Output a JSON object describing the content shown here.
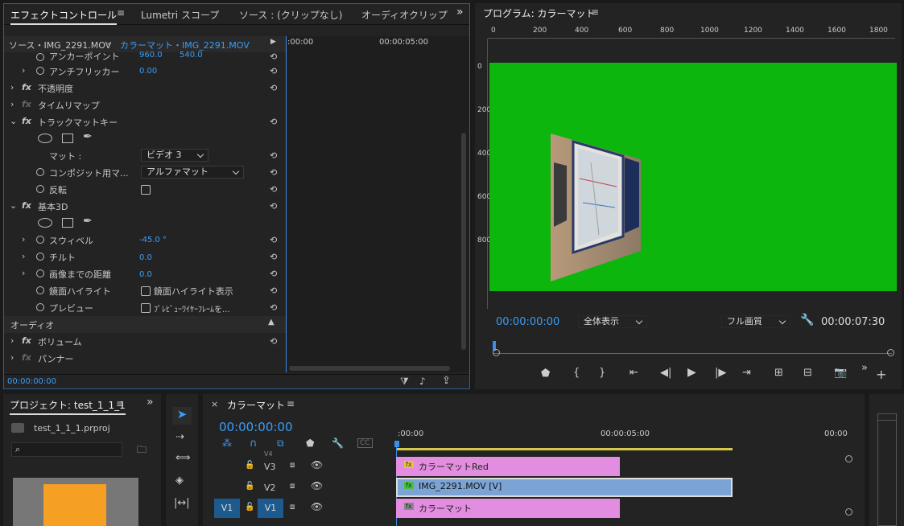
{
  "effect_panel": {
    "tabs": [
      "エフェクトコントロール",
      "Lumetri スコープ",
      "ソース : (クリップなし)",
      "オーディオクリップ"
    ],
    "menu_icon": "hamburger-icon",
    "source_label": "ソース・IMG_2291.MOV",
    "clip_label": "カラーマット・IMG_2291.MOV",
    "time_start": ":00:00",
    "time_mid": "00:00:05:00",
    "anchor": {
      "label": "アンカーポイント",
      "x": "960.0",
      "y": "540.0"
    },
    "antiflicker": {
      "label": "アンチフリッカー",
      "value": "0.00"
    },
    "opacity": "不透明度",
    "timeremap": "タイムリマップ",
    "trackmatte": "トラックマットキー",
    "matte": {
      "label": "マット :",
      "value": "ビデオ 3"
    },
    "composite": {
      "label": "コンポジット用マ...",
      "value": "アルファマット"
    },
    "invert": "反転",
    "basic3d": "基本3D",
    "swivel": {
      "label": "スウィベル",
      "value": "-45.0 °"
    },
    "tilt": {
      "label": "チルト",
      "value": "0.0"
    },
    "distance": {
      "label": "画像までの距離",
      "value": "0.0"
    },
    "specular": {
      "label": "鏡面ハイライト",
      "check_label": "鏡面ハイライト表示"
    },
    "preview": {
      "label": "プレビュー",
      "check_label": "ﾌﾟﾚﾋﾞｭｰﾜｲﾔｰﾌﾚｰﾑを..."
    },
    "audio_header": "オーディオ",
    "volume": "ボリューム",
    "panner": "パンナー",
    "footer_time": "00:00:00:00"
  },
  "program": {
    "title": "プログラム: カラーマット",
    "ruler": [
      "0",
      "200",
      "400",
      "600",
      "800",
      "1000",
      "1200",
      "1400",
      "1600",
      "1800"
    ],
    "vruler": [
      "0",
      "200",
      "400",
      "600",
      "800"
    ],
    "timecode": "00:00:00:00",
    "zoom": "全体表示",
    "quality": "フル画質",
    "duration": "00:00:07:30",
    "bg_color": "#0cb60c"
  },
  "project": {
    "title": "プロジェクト: test_1_1_1",
    "file": "test_1_1_1.prproj",
    "thumb_color": "#f5a023"
  },
  "timeline": {
    "title": "カラーマット",
    "timecode": "00:00:00:00",
    "ruler_start": ":00:00",
    "ruler_mid": "00:00:05:00",
    "ruler_end": "00:00",
    "tracks": [
      {
        "name": "V4"
      },
      {
        "name": "V3",
        "clip": "カラーマットRed",
        "color": "#e38de0"
      },
      {
        "name": "V2",
        "clip": "IMG_2291.MOV [V]",
        "color": "#7ba4d4"
      },
      {
        "name": "V1",
        "target": "V1",
        "clip": "カラーマット",
        "color": "#e38de0"
      }
    ]
  }
}
